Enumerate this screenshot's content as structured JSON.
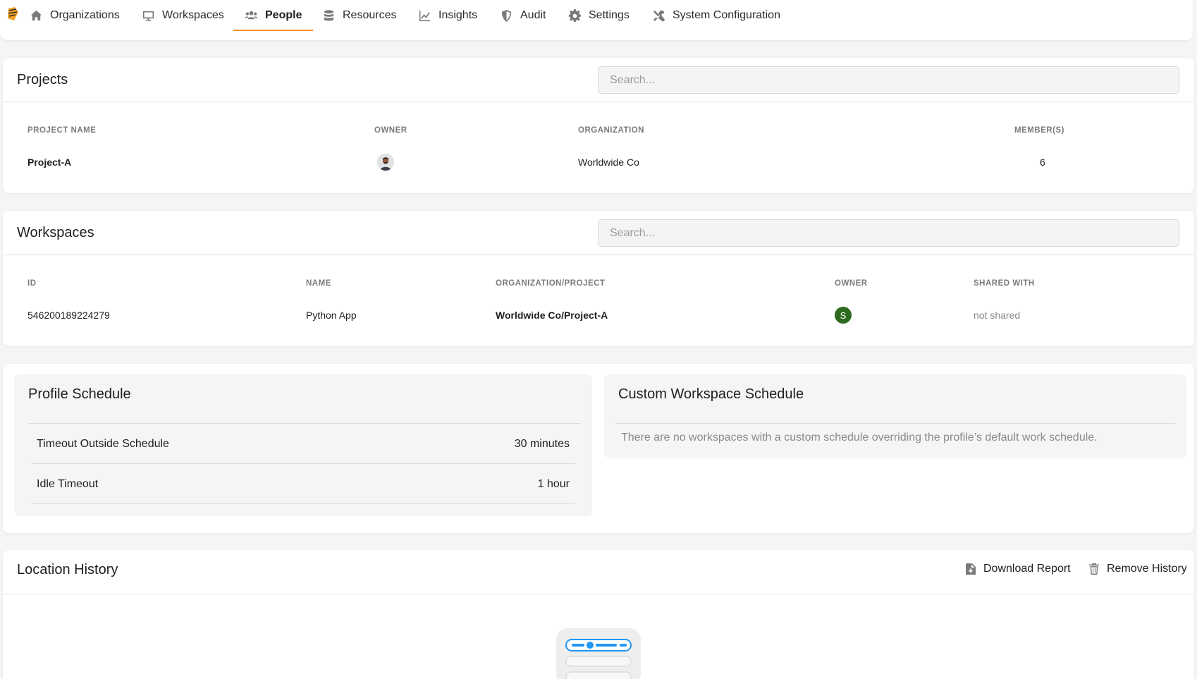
{
  "nav": {
    "items": [
      {
        "label": "Organizations",
        "icon": "home-icon"
      },
      {
        "label": "Workspaces",
        "icon": "monitor-icon"
      },
      {
        "label": "People",
        "icon": "people-icon",
        "active": true
      },
      {
        "label": "Resources",
        "icon": "database-icon"
      },
      {
        "label": "Insights",
        "icon": "chart-line-icon"
      },
      {
        "label": "Audit",
        "icon": "shield-icon"
      },
      {
        "label": "Settings",
        "icon": "gear-icon"
      },
      {
        "label": "System Configuration",
        "icon": "tools-icon"
      }
    ],
    "accent_color": "#f0932b"
  },
  "projects": {
    "title": "Projects",
    "search_placeholder": "Search...",
    "columns": [
      "PROJECT NAME",
      "OWNER",
      "ORGANIZATION",
      "MEMBER(S)"
    ],
    "rows": [
      {
        "name": "Project-A",
        "organization": "Worldwide Co",
        "members": "6"
      }
    ]
  },
  "workspaces": {
    "title": "Workspaces",
    "search_placeholder": "Search...",
    "columns": [
      "ID",
      "NAME",
      "ORGANIZATION/PROJECT",
      "OWNER",
      "SHARED WITH"
    ],
    "rows": [
      {
        "id": "546200189224279",
        "name": "Python App",
        "org_project": "Worldwide Co/Project-A",
        "owner_initial": "S",
        "shared_with": "not shared"
      }
    ]
  },
  "profile_schedule": {
    "title": "Profile Schedule",
    "rows": [
      {
        "label": "Timeout Outside Schedule",
        "value": "30 minutes"
      },
      {
        "label": "Idle Timeout",
        "value": "1 hour"
      }
    ]
  },
  "custom_schedule": {
    "title": "Custom Workspace Schedule",
    "empty_text": "There are no workspaces with a custom schedule overriding the profile’s default work schedule."
  },
  "location_history": {
    "title": "Location History",
    "download_label": "Download Report",
    "remove_label": "Remove History"
  }
}
